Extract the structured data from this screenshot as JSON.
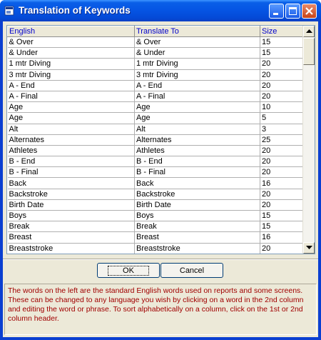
{
  "window": {
    "title": "Translation of Keywords"
  },
  "table": {
    "columns": [
      "English",
      "Translate To",
      "Size"
    ],
    "rows": [
      [
        "& Over",
        "& Over",
        "15"
      ],
      [
        "& Under",
        "& Under",
        "15"
      ],
      [
        "1 mtr Diving",
        "1 mtr Diving",
        "20"
      ],
      [
        "3 mtr Diving",
        "3 mtr Diving",
        "20"
      ],
      [
        "A - End",
        "A - End",
        "20"
      ],
      [
        "A - Final",
        "A - Final",
        "20"
      ],
      [
        "Age",
        "Age",
        "10"
      ],
      [
        "Age",
        "Age",
        "5"
      ],
      [
        "Alt",
        "Alt",
        "3"
      ],
      [
        "Alternates",
        "Alternates",
        "25"
      ],
      [
        "Athletes",
        "Athletes",
        "20"
      ],
      [
        "B - End",
        "B - End",
        "20"
      ],
      [
        "B - Final",
        "B - Final",
        "20"
      ],
      [
        "Back",
        "Back",
        "16"
      ],
      [
        "Backstroke",
        "Backstroke",
        "20"
      ],
      [
        "Birth Date",
        "Birth Date",
        "20"
      ],
      [
        "Boys",
        "Boys",
        "15"
      ],
      [
        "Break",
        "Break",
        "15"
      ],
      [
        "Breast",
        "Breast",
        "16"
      ],
      [
        "Breaststroke",
        "Breaststroke",
        "20"
      ]
    ]
  },
  "buttons": {
    "ok": "OK",
    "cancel": "Cancel"
  },
  "help_text": "The words on the left are the standard English words used on reports and some screens. These can be changed to any language you wish by clicking on a word in the 2nd column and editing the word or phrase. To sort alphabetically on a column, click on the 1st or 2nd column header.",
  "colors": {
    "title_bar": "#0554e3",
    "header_text": "#0000cc",
    "help_text": "#a00000",
    "dialog_bg": "#ece9d8"
  }
}
